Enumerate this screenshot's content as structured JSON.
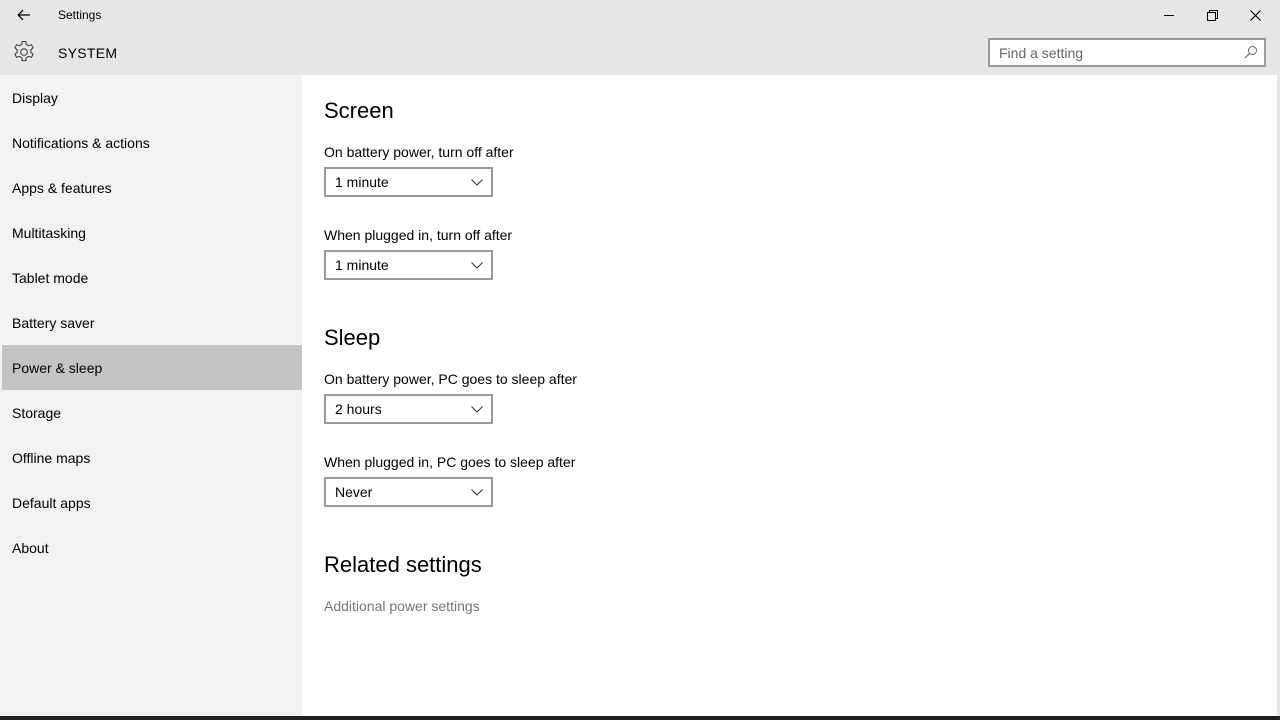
{
  "window": {
    "title": "Settings",
    "controls": {
      "minimize": "minimize-icon",
      "maximize": "restore-icon",
      "close": "close-icon"
    }
  },
  "header": {
    "icon": "gear-icon",
    "title": "SYSTEM",
    "search": {
      "placeholder": "Find a setting",
      "value": ""
    }
  },
  "sidebar": {
    "items": [
      {
        "label": "Display"
      },
      {
        "label": "Notifications & actions"
      },
      {
        "label": "Apps & features"
      },
      {
        "label": "Multitasking"
      },
      {
        "label": "Tablet mode"
      },
      {
        "label": "Battery saver"
      },
      {
        "label": "Power & sleep",
        "selected": true
      },
      {
        "label": "Storage"
      },
      {
        "label": "Offline maps"
      },
      {
        "label": "Default apps"
      },
      {
        "label": "About"
      }
    ]
  },
  "main": {
    "screen": {
      "title": "Screen",
      "battery_label": "On battery power, turn off after",
      "battery_value": "1 minute",
      "plugged_label": "When plugged in, turn off after",
      "plugged_value": "1 minute"
    },
    "sleep": {
      "title": "Sleep",
      "battery_label": "On battery power, PC goes to sleep after",
      "battery_value": "2 hours",
      "plugged_label": "When plugged in, PC goes to sleep after",
      "plugged_value": "Never"
    },
    "related": {
      "title": "Related settings",
      "link": "Additional power settings"
    }
  },
  "colors": {
    "titlebar": "#e6e6e6",
    "sidebar": "#f2f2f2",
    "selected": "#c6c4c3",
    "link": "#767676"
  }
}
